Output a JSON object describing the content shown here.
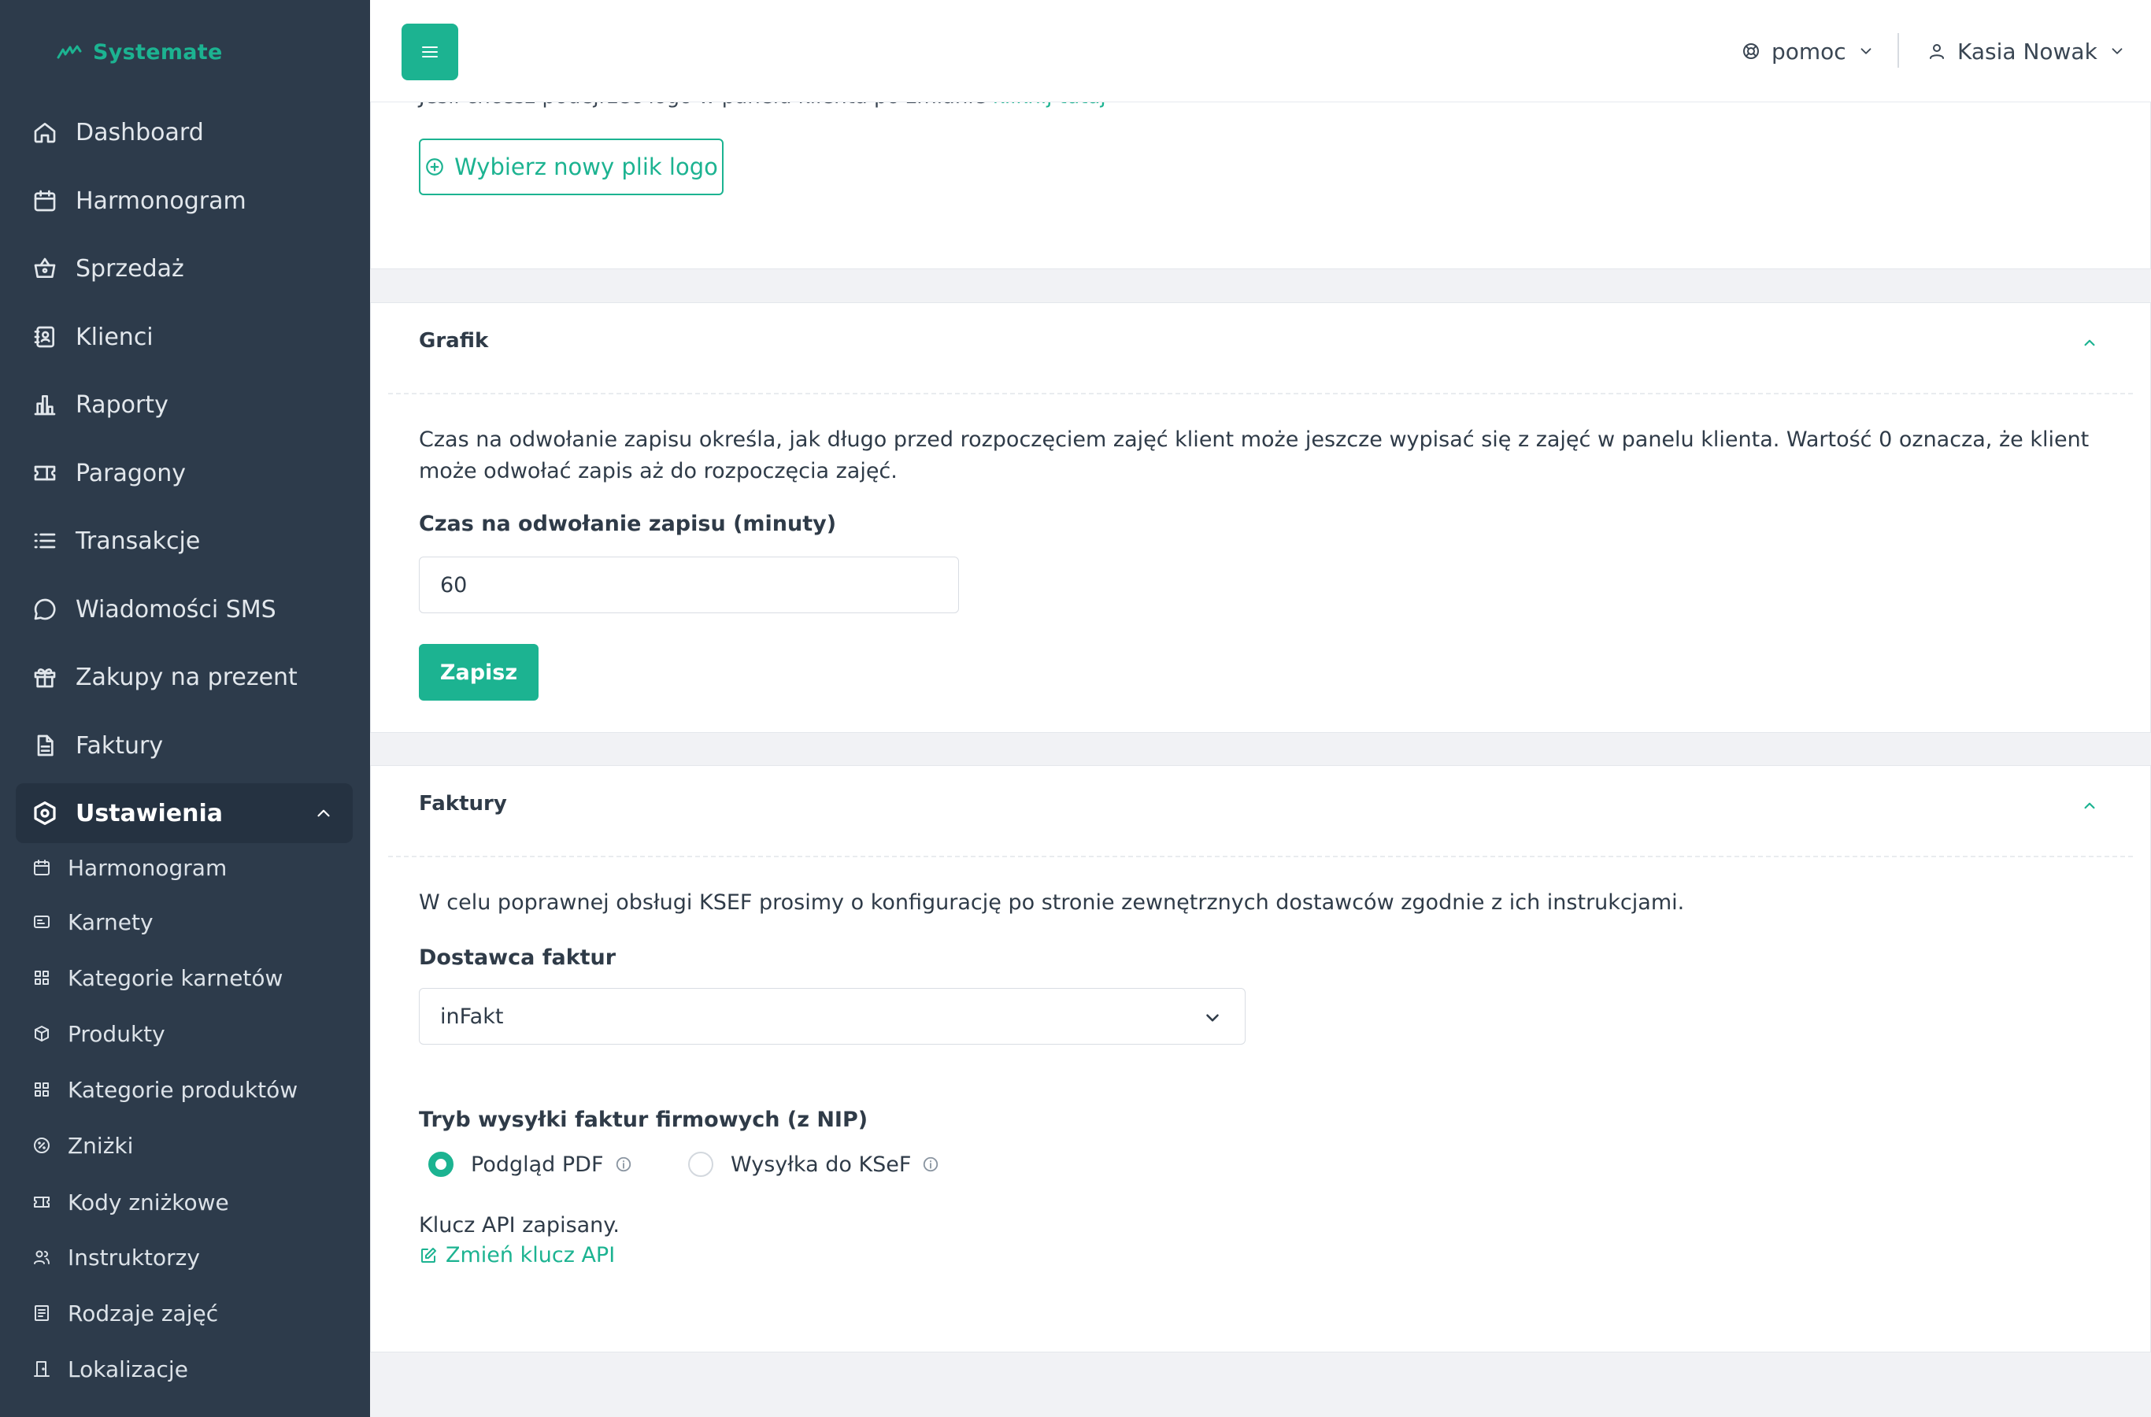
{
  "brand": {
    "name": "Systemate",
    "color": "#1cb391"
  },
  "sidebar": {
    "items": [
      {
        "label": "Dashboard",
        "icon": "home-icon"
      },
      {
        "label": "Harmonogram",
        "icon": "calendar-icon"
      },
      {
        "label": "Sprzedaż",
        "icon": "basket-icon"
      },
      {
        "label": "Klienci",
        "icon": "contacts-icon"
      },
      {
        "label": "Raporty",
        "icon": "bar-chart-icon"
      },
      {
        "label": "Paragony",
        "icon": "ticket-icon"
      },
      {
        "label": "Transakcje",
        "icon": "list-icon"
      },
      {
        "label": "Wiadomości SMS",
        "icon": "chat-icon"
      },
      {
        "label": "Zakupy na prezent",
        "icon": "gift-icon"
      },
      {
        "label": "Faktury",
        "icon": "document-icon"
      },
      {
        "label": "Ustawienia",
        "icon": "settings-hex-icon",
        "active": true
      }
    ],
    "sub_items": [
      {
        "label": "Harmonogram",
        "icon": "calendar-icon"
      },
      {
        "label": "Karnety",
        "icon": "pass-card-icon"
      },
      {
        "label": "Kategorie karnetów",
        "icon": "grid-icon"
      },
      {
        "label": "Produkty",
        "icon": "box-icon"
      },
      {
        "label": "Kategorie produktów",
        "icon": "grid-icon"
      },
      {
        "label": "Zniżki",
        "icon": "percent-icon"
      },
      {
        "label": "Kody zniżkowe",
        "icon": "ticket-icon"
      },
      {
        "label": "Instruktorzy",
        "icon": "users-icon"
      },
      {
        "label": "Rodzaje zajęć",
        "icon": "list-check-icon"
      },
      {
        "label": "Lokalizacje",
        "icon": "door-icon"
      }
    ]
  },
  "topbar": {
    "help_label": "pomoc",
    "user_name": "Kasia Nowak"
  },
  "logo_card": {
    "clipped_text": "Jeśli chcesz podejrzeć logo w panelu klienta po zmianie ",
    "clipped_link": "kliknij tutaj",
    "button_label": "Wybierz nowy plik logo"
  },
  "grafik_card": {
    "title": "Grafik",
    "description": "Czas na odwołanie zapisu określa, jak długo przed rozpoczęciem zajęć klient może jeszcze wypisać się z zajęć w panelu klienta. Wartość 0 oznacza, że klient może odwołać zapis aż do rozpoczęcia zajęć.",
    "field_label": "Czas na odwołanie zapisu (minuty)",
    "field_value": "60",
    "save_label": "Zapisz"
  },
  "faktury_card": {
    "title": "Faktury",
    "description": "W celu poprawnej obsługi KSEF prosimy o konfigurację po stronie zewnętrznych dostawców zgodnie z ich instrukcjami.",
    "provider_label": "Dostawca faktur",
    "provider_value": "inFakt",
    "mode_label": "Tryb wysyłki faktur firmowych (z NIP)",
    "options": [
      {
        "label": "Podgląd PDF",
        "checked": true
      },
      {
        "label": "Wysyłka do KSeF",
        "checked": false
      }
    ],
    "api_status": "Klucz API zapisany.",
    "api_link": "Zmień klucz API"
  }
}
